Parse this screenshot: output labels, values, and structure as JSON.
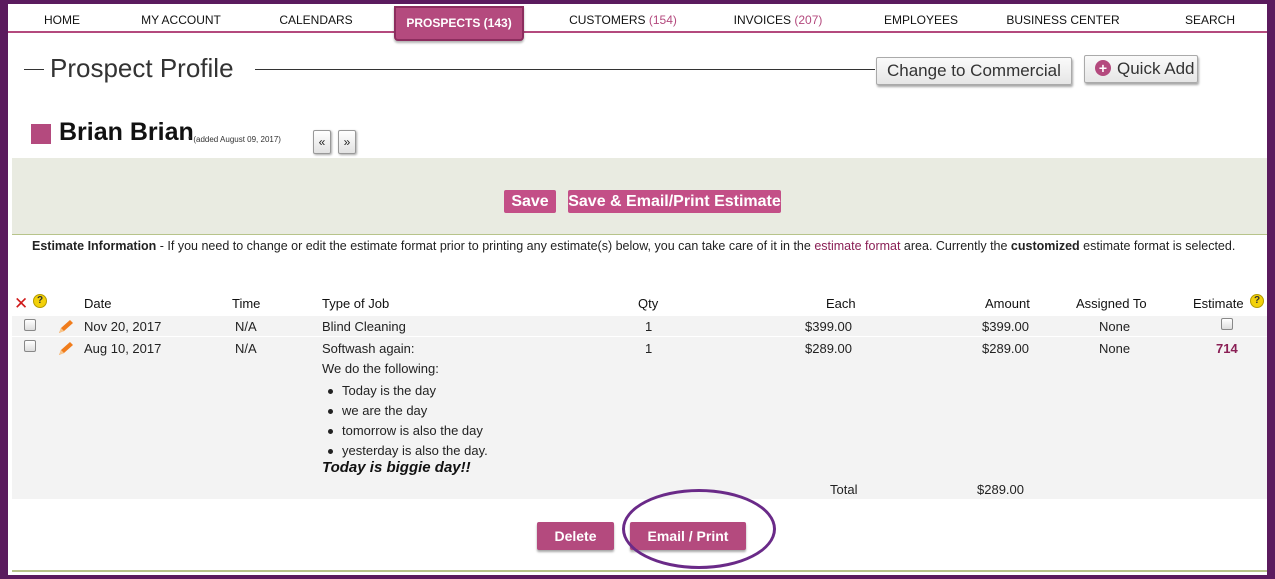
{
  "nav": {
    "items": [
      {
        "label": "HOME",
        "count": ""
      },
      {
        "label": "MY ACCOUNT",
        "count": ""
      },
      {
        "label": "CALENDARS",
        "count": ""
      },
      {
        "label": "PROSPECTS",
        "count": "(143)"
      },
      {
        "label": "CUSTOMERS",
        "count": "(154)"
      },
      {
        "label": "INVOICES",
        "count": "(207)"
      },
      {
        "label": "EMPLOYEES",
        "count": ""
      },
      {
        "label": "BUSINESS CENTER",
        "count": ""
      },
      {
        "label": "SEARCH",
        "count": ""
      }
    ],
    "active": "PROSPECTS"
  },
  "header": {
    "title": "Prospect Profile",
    "change_button": "Change to Commercial",
    "quick_add_button": "Quick Add",
    "quick_add_icon": "plus-circle-icon"
  },
  "prospect": {
    "name": "Brian Brian",
    "added": "* (added August 09, 2017)",
    "prev_label": "«",
    "next_label": "»"
  },
  "actions": {
    "save": "Save",
    "save_email": "Save & Email/Print Estimate"
  },
  "estimate_info": {
    "heading": "Estimate Information",
    "text1": " - If you need to change or edit the estimate format prior to printing any estimate(s) below, you can take care of it in the ",
    "link": "estimate format",
    "text2": " area. Currently the ",
    "format": "customized",
    "text3": " estimate format is selected."
  },
  "table": {
    "headers": {
      "date": "Date",
      "time": "Time",
      "type": "Type of Job",
      "qty": "Qty",
      "each": "Each",
      "amount": "Amount",
      "assigned": "Assigned To",
      "estimate": "Estimate"
    },
    "help_glyph": "?",
    "rows": [
      {
        "date": "Nov 20, 2017",
        "time": "N/A",
        "type": "Blind Cleaning",
        "qty": "1",
        "each": "$399.00",
        "amount": "$399.00",
        "assigned": "None",
        "estimate": ""
      },
      {
        "date": "Aug 10, 2017",
        "time": "N/A",
        "type": "Softwash again:",
        "qty": "1",
        "each": "$289.00",
        "amount": "$289.00",
        "assigned": "None",
        "estimate": "714",
        "intro": "We do the following:",
        "bullets": [
          "Today is the day",
          "we are the day",
          "tomorrow is also the day",
          "yesterday is also the day."
        ],
        "note": "Today is biggie day!!"
      }
    ],
    "total_label": "Total",
    "total_value": "$289.00"
  },
  "footer": {
    "delete": "Delete",
    "email_print": "Email / Print"
  },
  "colors": {
    "accent": "#b44a7e",
    "frame": "#5b1b5e",
    "link": "#8a1f55",
    "band": "#e9ebe1"
  }
}
